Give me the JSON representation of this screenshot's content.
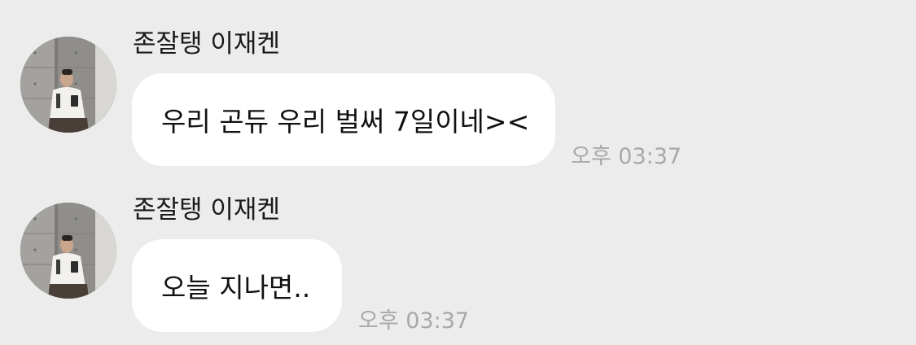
{
  "messages": [
    {
      "sender": "존잘탱 이재켄",
      "text": "우리 곤듀 우리 벌써 7일이네><",
      "time": "오후 03:37",
      "avatar_icon": "profile-photo"
    },
    {
      "sender": "존잘탱 이재켄",
      "text": "오늘 지나면..",
      "time": "오후 03:37",
      "avatar_icon": "profile-photo"
    }
  ],
  "colors": {
    "background": "#ececec",
    "bubble": "#ffffff",
    "text": "#111111",
    "timestamp": "#a8a8a8"
  }
}
